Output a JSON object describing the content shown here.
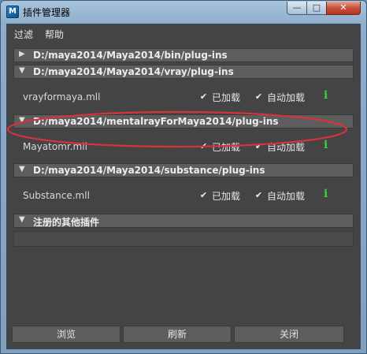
{
  "window": {
    "title": "插件管理器",
    "app_icon_glyph": "M",
    "controls": {
      "minimize": "—",
      "maximize": "□",
      "close": "✕"
    }
  },
  "menu": [
    "过滤",
    "帮助"
  ],
  "sections": [
    {
      "path": "D:/maya2014/Maya2014/bin/plug-ins",
      "expanded": false,
      "plugins": []
    },
    {
      "path": "D:/maya2014/Maya2014/vray/plug-ins",
      "expanded": true,
      "plugins": [
        {
          "name": "vrayformaya.mll",
          "loaded": true,
          "auto_load": true
        }
      ]
    },
    {
      "path": "D:/maya2014/mentalrayForMaya2014/plug-ins",
      "expanded": true,
      "plugins": [
        {
          "name": "Mayatomr.mll",
          "loaded": true,
          "auto_load": true
        }
      ]
    },
    {
      "path": "D:/maya2014/Maya2014/substance/plug-ins",
      "expanded": true,
      "plugins": [
        {
          "name": "Substance.mll",
          "loaded": true,
          "auto_load": true
        }
      ]
    },
    {
      "path": "注册的其他插件",
      "expanded": true,
      "plugins": []
    }
  ],
  "labels": {
    "loaded": "已加载",
    "auto_load": "自动加载",
    "info_glyph": "i",
    "check_glyph": "✔",
    "tri_collapsed": "▶",
    "tri_expanded": "▼"
  },
  "buttons": {
    "browse": "浏览",
    "refresh": "刷新",
    "close": "关闭"
  },
  "colors": {
    "highlight": "#d8323a",
    "info": "#35d335",
    "panel": "#444444"
  }
}
